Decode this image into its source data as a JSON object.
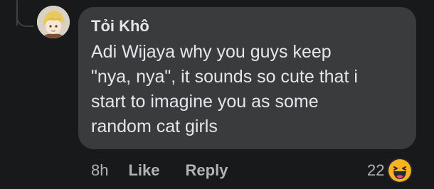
{
  "comment": {
    "author": "Tỏi Khô",
    "text": "Adi Wijaya why you guys keep\n\"nya, nya\", it sounds so cute that i\nstart to imagine you as some\nrandom cat girls",
    "timestamp": "8h",
    "like_label": "Like",
    "reply_label": "Reply",
    "reaction_count": "22",
    "reaction_icon": "haha-emoji-icon"
  },
  "colors": {
    "background": "#18191a",
    "bubble": "#3a3b3c",
    "text_primary": "#e4e6eb",
    "text_secondary": "#b0b3b8",
    "reaction_yellow": "#f7b125"
  }
}
